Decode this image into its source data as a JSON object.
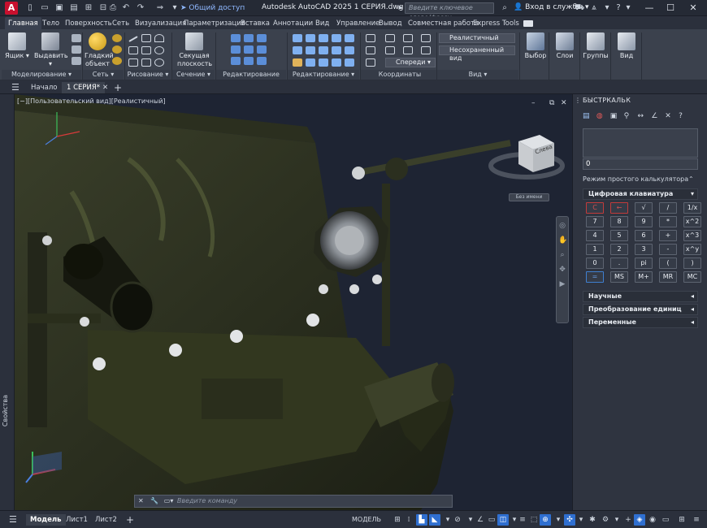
{
  "titlebar": {
    "app_logo": "A",
    "share_label": "Общий доступ",
    "title": "Autodesk AutoCAD 2025    1 СЕРИЯ.dwg",
    "search_placeholder": "Введите ключевое слово/фразу",
    "signin_label": "Вход в службы"
  },
  "ribbon_tabs": [
    "Главная",
    "Тело",
    "Поверхность",
    "Сеть",
    "Визуализация",
    "Параметризация",
    "Вставка",
    "Аннотации",
    "Вид",
    "Управление",
    "Вывод",
    "Совместная работа",
    "Express Tools"
  ],
  "ribbon": {
    "modeling": {
      "box_label": "Ящик",
      "extrude_label": "Выдавить",
      "panel_title": "Моделирование"
    },
    "mesh": {
      "smooth_label": "Гладкий объект",
      "panel_title": "Сеть"
    },
    "draw": {
      "panel_title": "Рисование"
    },
    "section": {
      "plane_label": "Секущая плоскость",
      "panel_title": "Сечение"
    },
    "solid_edit": {
      "panel_title": "Редактирование тела"
    },
    "modify": {
      "panel_title": "Редактирование"
    },
    "coords": {
      "panel_title": "Координаты",
      "front_label": "Спереди"
    },
    "view": {
      "visual_style": "Реалистичный",
      "saved_view": "Несохраненный вид",
      "panel_title": "Вид"
    },
    "select_label": "Выбор",
    "layers_label": "Слои",
    "groups_label": "Группы",
    "view_label": "Вид"
  },
  "file_tabs": {
    "start": "Начало",
    "current": "1 СЕРИЯ*"
  },
  "viewport": {
    "label": "[−][Пользовательский вид][Реалистичный]",
    "viewcube_face": "Слева",
    "unnamed": "Без имени"
  },
  "side_label": "Свойства",
  "calc": {
    "title": "БЫСТРКАЛЬК",
    "result": "0",
    "mode": "Режим простого калькулятора",
    "keypad_title": "Цифровая клавиатура",
    "keys": [
      [
        "С",
        "←",
        "√",
        "/",
        "1/x"
      ],
      [
        "7",
        "8",
        "9",
        "*",
        "x^2"
      ],
      [
        "4",
        "5",
        "6",
        "+",
        "x^3"
      ],
      [
        "1",
        "2",
        "3",
        "-",
        "x^y"
      ],
      [
        "0",
        ".",
        "pi",
        "(",
        ")"
      ],
      [
        "=",
        "MS",
        "M+",
        "MR",
        "MC"
      ]
    ],
    "sections": [
      "Научные",
      "Преобразование единиц",
      "Переменные"
    ]
  },
  "cmd": {
    "placeholder": "Введите команду"
  },
  "status": {
    "model": "Модель",
    "sheet1": "Лист1",
    "sheet2": "Лист2",
    "model_btn": "МОДЕЛЬ"
  },
  "colors": {
    "accent": "#2f6fd0",
    "logo": "#c8102e"
  }
}
